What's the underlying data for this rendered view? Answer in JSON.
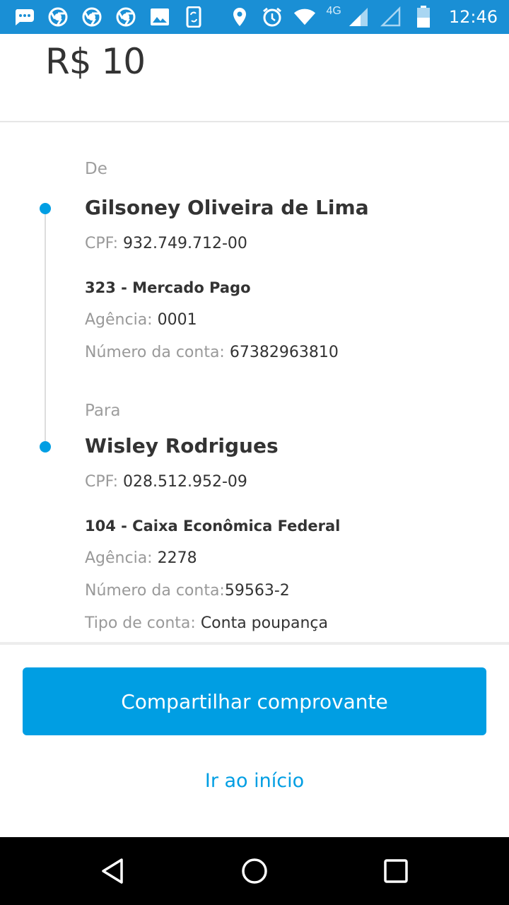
{
  "status_bar": {
    "time": "12:46",
    "network": "4G",
    "icons": [
      "chat-bubble-icon",
      "chrome-icon",
      "chrome-icon",
      "chrome-icon",
      "image-icon",
      "phone-sync-icon",
      "location-icon",
      "alarm-icon",
      "wifi-icon",
      "signal-icon",
      "signal-empty-icon",
      "battery-icon"
    ]
  },
  "receipt": {
    "amount": "R$ 10",
    "from": {
      "label": "De",
      "name": "Gilsoney Oliveira de Lima",
      "cpf_label": "CPF:",
      "cpf": "932.749.712-00",
      "bank": "323 - Mercado Pago",
      "agency_label": "Agência:",
      "agency": "0001",
      "account_label": "Número da conta:",
      "account": "67382963810"
    },
    "to": {
      "label": "Para",
      "name": "Wisley Rodrigues",
      "cpf_label": "CPF:",
      "cpf": "028.512.952-09",
      "bank": "104 - Caixa Econômica Federal",
      "agency_label": "Agência:",
      "agency": "2278",
      "account_label": "Número da conta:",
      "account": "59563-2",
      "type_label": "Tipo de conta:",
      "type": "Conta poupança"
    }
  },
  "actions": {
    "share_label": "Compartilhar comprovante",
    "home_label": "Ir ao início"
  },
  "colors": {
    "accent": "#009ee3",
    "status_bar": "#1a8fd5"
  },
  "nav_bar": {
    "buttons": [
      "back-icon",
      "home-icon",
      "recents-icon"
    ]
  }
}
